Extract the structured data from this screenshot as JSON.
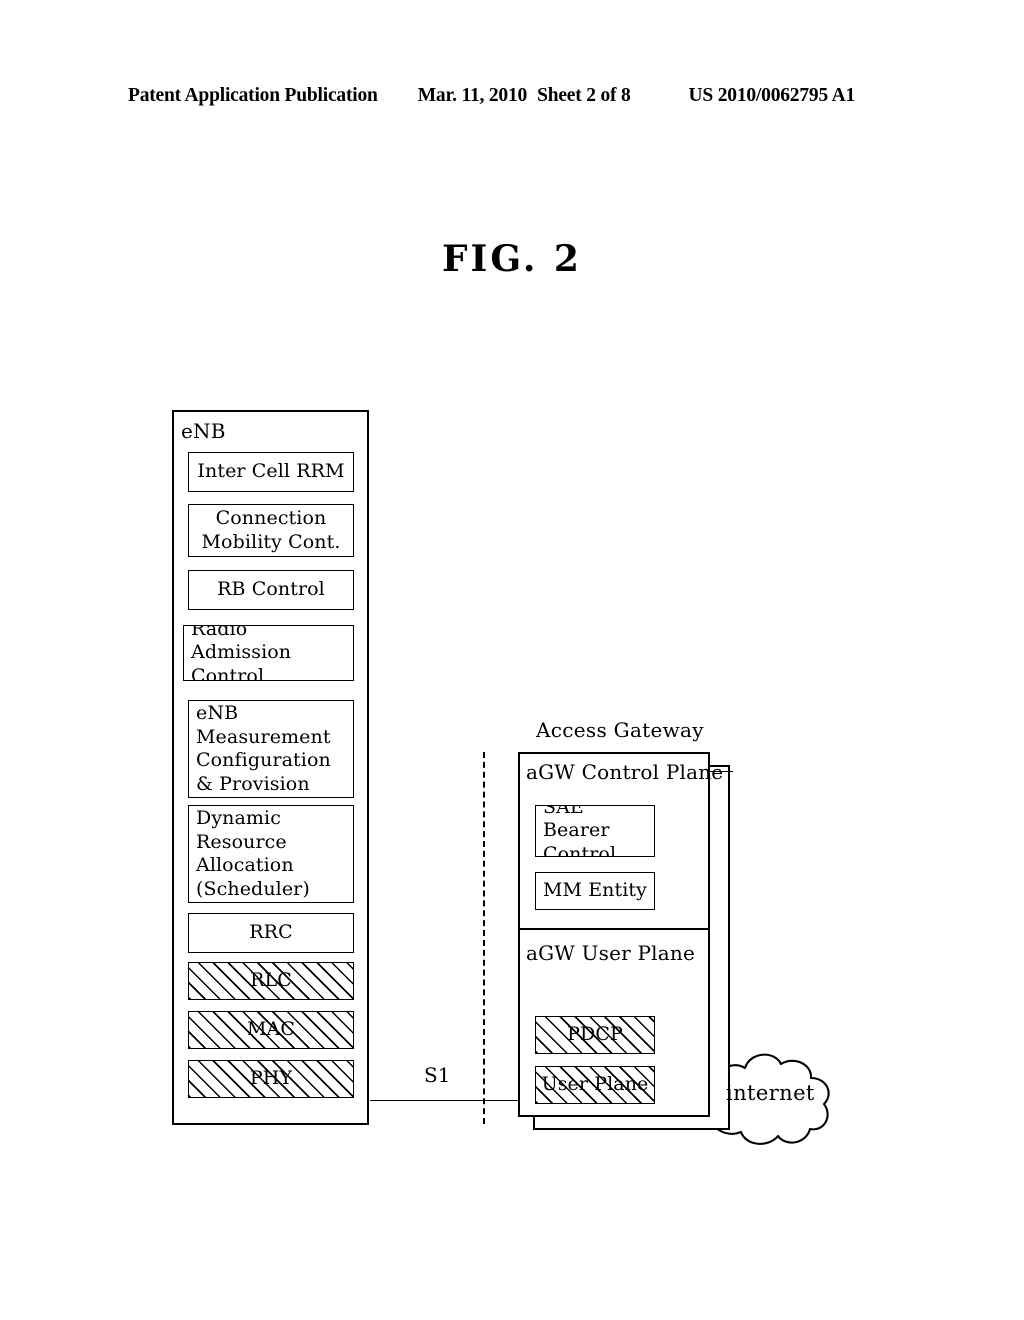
{
  "header": {
    "publication": "Patent Application Publication",
    "date": "Mar. 11, 2010",
    "sheet": "Sheet 2 of 8",
    "patent_number": "US 2010/0062795 A1"
  },
  "figure": {
    "title": "FIG. 2"
  },
  "diagram": {
    "enb": {
      "title": "eNB",
      "units": [
        {
          "label": "Inter Cell RRM",
          "align": "center",
          "hatched": false
        },
        {
          "label": "Connection\nMobility Cont.",
          "align": "center",
          "hatched": false
        },
        {
          "label": "RB Control",
          "align": "center",
          "hatched": false
        },
        {
          "label": "Radio Admission\nControl",
          "align": "left",
          "hatched": false
        },
        {
          "label": "eNB\nMeasurement\nConfiguration\n& Provision",
          "align": "left",
          "hatched": false
        },
        {
          "label": "Dynamic\nResource\nAllocation\n(Scheduler)",
          "align": "left",
          "hatched": false
        },
        {
          "label": "RRC",
          "align": "center",
          "hatched": false
        },
        {
          "label": "RLC",
          "align": "center",
          "hatched": true
        },
        {
          "label": "MAC",
          "align": "center",
          "hatched": true
        },
        {
          "label": "PHY",
          "align": "center",
          "hatched": true
        }
      ]
    },
    "access_gateway": {
      "caption": "Access Gateway",
      "control_plane": {
        "title": "aGW Control Plane",
        "units": [
          {
            "label": "SAE Bearer\nControl",
            "align": "left",
            "hatched": false
          },
          {
            "label": "MM Entity",
            "align": "center",
            "hatched": false
          }
        ]
      },
      "user_plane": {
        "title": "aGW User Plane",
        "units": [
          {
            "label": "PDCP",
            "align": "center",
            "hatched": true
          },
          {
            "label": "User Plane",
            "align": "center",
            "hatched": true
          }
        ]
      }
    },
    "interface": {
      "label": "S1"
    },
    "network": {
      "label": "internet"
    }
  }
}
